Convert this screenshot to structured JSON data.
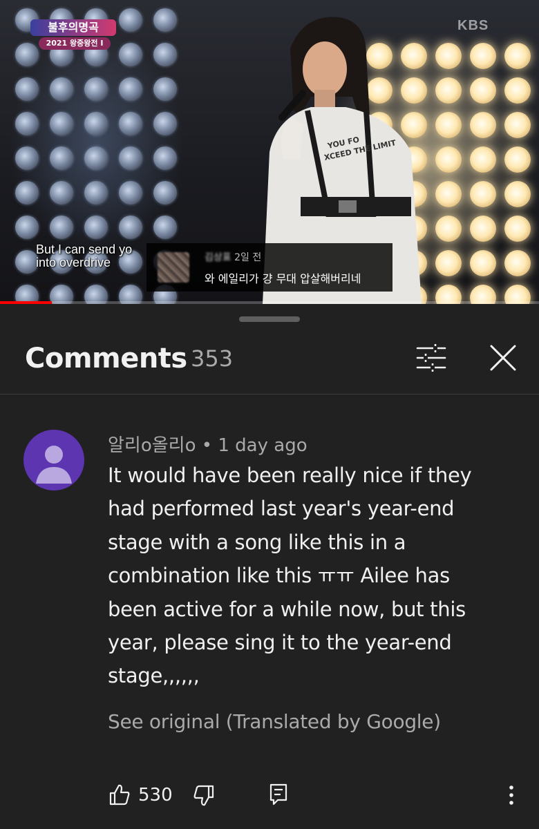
{
  "video": {
    "show_logo_title": "불후의명곡",
    "show_logo_subtitle": "2021 왕중왕전 I",
    "channel_watermark": "KBS",
    "lyric_line1": "But I can send yo",
    "lyric_line2": "into overdrive",
    "overlay_comment": {
      "author": "김상표",
      "time": "2일 전",
      "text": "와 에일리가 걍 무대 압살해버리네"
    },
    "progress_fraction": 0.096
  },
  "comments_panel": {
    "title": "Comments",
    "count": "353",
    "icons": {
      "filter": "sort-filter-icon",
      "close": "close-icon"
    }
  },
  "comment": {
    "author": "알리o올리o",
    "separator": "•",
    "time": "1 day ago",
    "body_lines": [
      "It would have been really nice if they",
      "had performed last year's year-end",
      "stage with a song like this in a",
      "combination like this ㅠㅠ Ailee has",
      "been active for a while now, but this",
      "year, please sing it to the year-end",
      "stage,,,,,,"
    ],
    "see_original": "See original (Translated by Google)",
    "like_count": "530",
    "avatar_color": "#5e35b1",
    "icons": [
      "thumb-up-icon",
      "thumb-down-icon",
      "reply-icon",
      "more-vert-icon"
    ]
  }
}
